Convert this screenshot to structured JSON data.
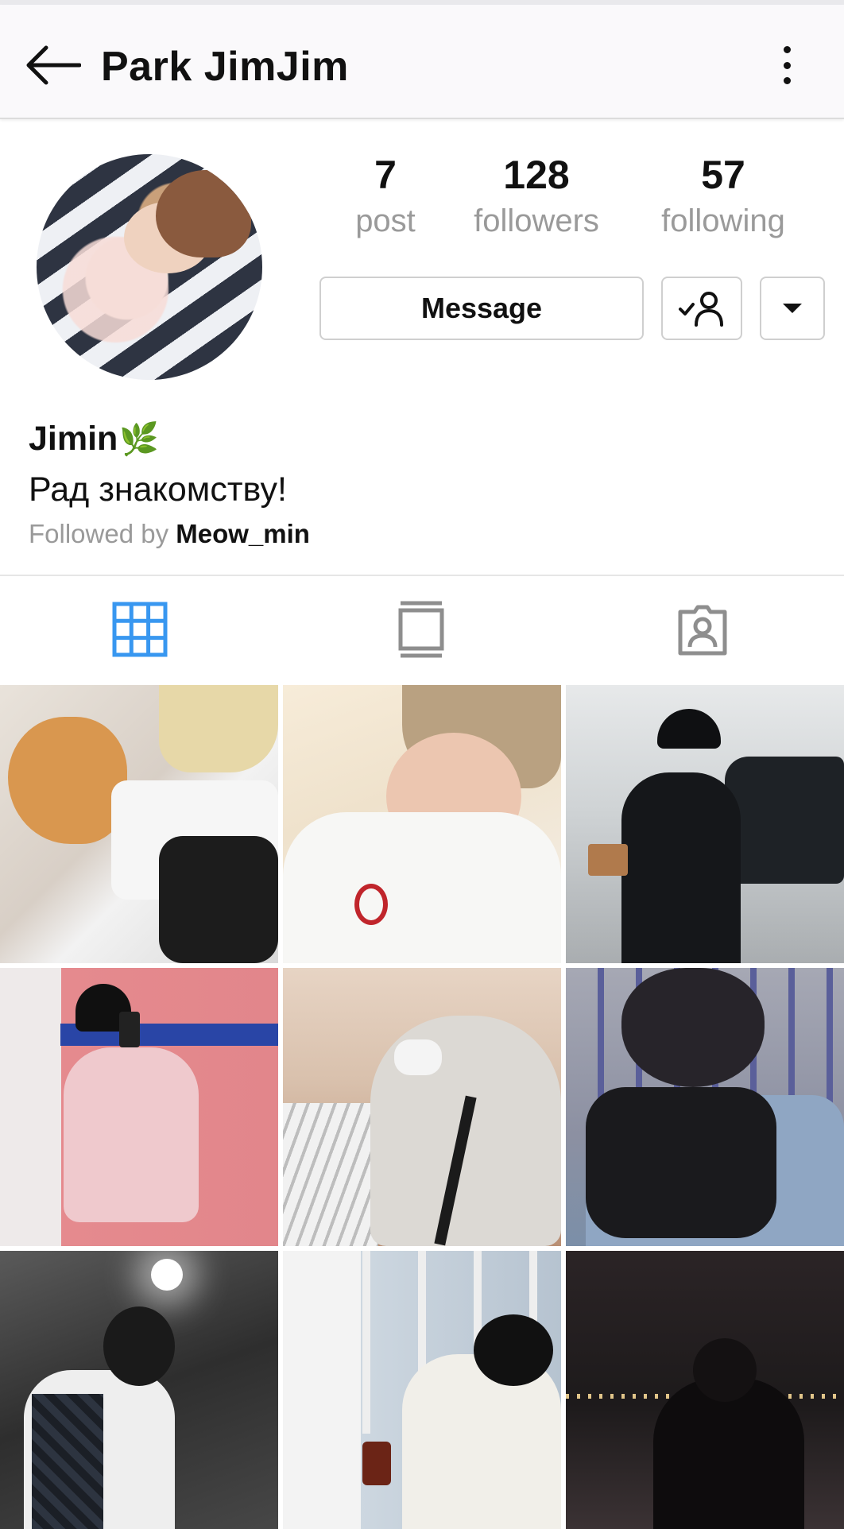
{
  "appbar": {
    "title": "Park JimJim",
    "back_icon": "arrow-left-icon",
    "menu_icon": "more-vertical-icon"
  },
  "profile": {
    "stats": [
      {
        "value": "7",
        "label": "post"
      },
      {
        "value": "128",
        "label": "followers"
      },
      {
        "value": "57",
        "label": "following"
      }
    ],
    "message_label": "Message",
    "name": "Jimin",
    "name_emoji": "🌿",
    "bio": "Рад знакомству!",
    "followed_prefix": "Followed by",
    "followed_user": "Meow_min"
  },
  "tabs": [
    {
      "icon": "grid-icon",
      "active": true
    },
    {
      "icon": "feed-icon",
      "active": false
    },
    {
      "icon": "tagged-icon",
      "active": false
    }
  ],
  "colors": {
    "active_tab": "#3897f0",
    "inactive_tab": "#8e8e8e"
  },
  "photos": [
    {
      "alt": "cat-and-person"
    },
    {
      "alt": "peace-sign-selfie"
    },
    {
      "alt": "person-with-car"
    },
    {
      "alt": "mirror-selfie-pink-wall"
    },
    {
      "alt": "hoodie-mask-rooftop"
    },
    {
      "alt": "back-of-head-denim"
    },
    {
      "alt": "night-street-mask"
    },
    {
      "alt": "cafe-window-writing"
    },
    {
      "alt": "night-city-hoodie"
    }
  ]
}
